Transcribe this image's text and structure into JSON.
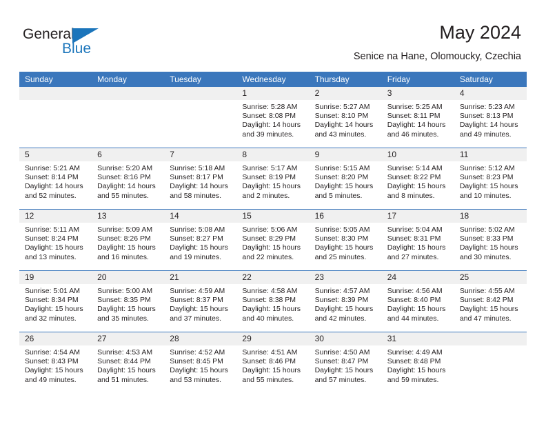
{
  "brand": {
    "name_part1": "General",
    "name_part2": "Blue",
    "accent_color": "#1b75bb"
  },
  "header": {
    "title": "May 2024",
    "subtitle": "Senice na Hane, Olomoucky, Czechia"
  },
  "theme": {
    "header_row_bg": "#3b77bc",
    "date_band_bg": "#f0f0f0",
    "separator_color": "#3b77bc",
    "text_color": "#231f20"
  },
  "weekdays": [
    "Sunday",
    "Monday",
    "Tuesday",
    "Wednesday",
    "Thursday",
    "Friday",
    "Saturday"
  ],
  "weeks": [
    {
      "days": [
        {
          "date": "",
          "empty": true,
          "sunrise": "",
          "sunset": "",
          "daylight_1": "",
          "daylight_2": ""
        },
        {
          "date": "",
          "empty": true,
          "sunrise": "",
          "sunset": "",
          "daylight_1": "",
          "daylight_2": ""
        },
        {
          "date": "",
          "empty": true,
          "sunrise": "",
          "sunset": "",
          "daylight_1": "",
          "daylight_2": ""
        },
        {
          "date": "1",
          "empty": false,
          "sunrise": "Sunrise: 5:28 AM",
          "sunset": "Sunset: 8:08 PM",
          "daylight_1": "Daylight: 14 hours",
          "daylight_2": "and 39 minutes."
        },
        {
          "date": "2",
          "empty": false,
          "sunrise": "Sunrise: 5:27 AM",
          "sunset": "Sunset: 8:10 PM",
          "daylight_1": "Daylight: 14 hours",
          "daylight_2": "and 43 minutes."
        },
        {
          "date": "3",
          "empty": false,
          "sunrise": "Sunrise: 5:25 AM",
          "sunset": "Sunset: 8:11 PM",
          "daylight_1": "Daylight: 14 hours",
          "daylight_2": "and 46 minutes."
        },
        {
          "date": "4",
          "empty": false,
          "sunrise": "Sunrise: 5:23 AM",
          "sunset": "Sunset: 8:13 PM",
          "daylight_1": "Daylight: 14 hours",
          "daylight_2": "and 49 minutes."
        }
      ]
    },
    {
      "days": [
        {
          "date": "5",
          "empty": false,
          "sunrise": "Sunrise: 5:21 AM",
          "sunset": "Sunset: 8:14 PM",
          "daylight_1": "Daylight: 14 hours",
          "daylight_2": "and 52 minutes."
        },
        {
          "date": "6",
          "empty": false,
          "sunrise": "Sunrise: 5:20 AM",
          "sunset": "Sunset: 8:16 PM",
          "daylight_1": "Daylight: 14 hours",
          "daylight_2": "and 55 minutes."
        },
        {
          "date": "7",
          "empty": false,
          "sunrise": "Sunrise: 5:18 AM",
          "sunset": "Sunset: 8:17 PM",
          "daylight_1": "Daylight: 14 hours",
          "daylight_2": "and 58 minutes."
        },
        {
          "date": "8",
          "empty": false,
          "sunrise": "Sunrise: 5:17 AM",
          "sunset": "Sunset: 8:19 PM",
          "daylight_1": "Daylight: 15 hours",
          "daylight_2": "and 2 minutes."
        },
        {
          "date": "9",
          "empty": false,
          "sunrise": "Sunrise: 5:15 AM",
          "sunset": "Sunset: 8:20 PM",
          "daylight_1": "Daylight: 15 hours",
          "daylight_2": "and 5 minutes."
        },
        {
          "date": "10",
          "empty": false,
          "sunrise": "Sunrise: 5:14 AM",
          "sunset": "Sunset: 8:22 PM",
          "daylight_1": "Daylight: 15 hours",
          "daylight_2": "and 8 minutes."
        },
        {
          "date": "11",
          "empty": false,
          "sunrise": "Sunrise: 5:12 AM",
          "sunset": "Sunset: 8:23 PM",
          "daylight_1": "Daylight: 15 hours",
          "daylight_2": "and 10 minutes."
        }
      ]
    },
    {
      "days": [
        {
          "date": "12",
          "empty": false,
          "sunrise": "Sunrise: 5:11 AM",
          "sunset": "Sunset: 8:24 PM",
          "daylight_1": "Daylight: 15 hours",
          "daylight_2": "and 13 minutes."
        },
        {
          "date": "13",
          "empty": false,
          "sunrise": "Sunrise: 5:09 AM",
          "sunset": "Sunset: 8:26 PM",
          "daylight_1": "Daylight: 15 hours",
          "daylight_2": "and 16 minutes."
        },
        {
          "date": "14",
          "empty": false,
          "sunrise": "Sunrise: 5:08 AM",
          "sunset": "Sunset: 8:27 PM",
          "daylight_1": "Daylight: 15 hours",
          "daylight_2": "and 19 minutes."
        },
        {
          "date": "15",
          "empty": false,
          "sunrise": "Sunrise: 5:06 AM",
          "sunset": "Sunset: 8:29 PM",
          "daylight_1": "Daylight: 15 hours",
          "daylight_2": "and 22 minutes."
        },
        {
          "date": "16",
          "empty": false,
          "sunrise": "Sunrise: 5:05 AM",
          "sunset": "Sunset: 8:30 PM",
          "daylight_1": "Daylight: 15 hours",
          "daylight_2": "and 25 minutes."
        },
        {
          "date": "17",
          "empty": false,
          "sunrise": "Sunrise: 5:04 AM",
          "sunset": "Sunset: 8:31 PM",
          "daylight_1": "Daylight: 15 hours",
          "daylight_2": "and 27 minutes."
        },
        {
          "date": "18",
          "empty": false,
          "sunrise": "Sunrise: 5:02 AM",
          "sunset": "Sunset: 8:33 PM",
          "daylight_1": "Daylight: 15 hours",
          "daylight_2": "and 30 minutes."
        }
      ]
    },
    {
      "days": [
        {
          "date": "19",
          "empty": false,
          "sunrise": "Sunrise: 5:01 AM",
          "sunset": "Sunset: 8:34 PM",
          "daylight_1": "Daylight: 15 hours",
          "daylight_2": "and 32 minutes."
        },
        {
          "date": "20",
          "empty": false,
          "sunrise": "Sunrise: 5:00 AM",
          "sunset": "Sunset: 8:35 PM",
          "daylight_1": "Daylight: 15 hours",
          "daylight_2": "and 35 minutes."
        },
        {
          "date": "21",
          "empty": false,
          "sunrise": "Sunrise: 4:59 AM",
          "sunset": "Sunset: 8:37 PM",
          "daylight_1": "Daylight: 15 hours",
          "daylight_2": "and 37 minutes."
        },
        {
          "date": "22",
          "empty": false,
          "sunrise": "Sunrise: 4:58 AM",
          "sunset": "Sunset: 8:38 PM",
          "daylight_1": "Daylight: 15 hours",
          "daylight_2": "and 40 minutes."
        },
        {
          "date": "23",
          "empty": false,
          "sunrise": "Sunrise: 4:57 AM",
          "sunset": "Sunset: 8:39 PM",
          "daylight_1": "Daylight: 15 hours",
          "daylight_2": "and 42 minutes."
        },
        {
          "date": "24",
          "empty": false,
          "sunrise": "Sunrise: 4:56 AM",
          "sunset": "Sunset: 8:40 PM",
          "daylight_1": "Daylight: 15 hours",
          "daylight_2": "and 44 minutes."
        },
        {
          "date": "25",
          "empty": false,
          "sunrise": "Sunrise: 4:55 AM",
          "sunset": "Sunset: 8:42 PM",
          "daylight_1": "Daylight: 15 hours",
          "daylight_2": "and 47 minutes."
        }
      ]
    },
    {
      "days": [
        {
          "date": "26",
          "empty": false,
          "sunrise": "Sunrise: 4:54 AM",
          "sunset": "Sunset: 8:43 PM",
          "daylight_1": "Daylight: 15 hours",
          "daylight_2": "and 49 minutes."
        },
        {
          "date": "27",
          "empty": false,
          "sunrise": "Sunrise: 4:53 AM",
          "sunset": "Sunset: 8:44 PM",
          "daylight_1": "Daylight: 15 hours",
          "daylight_2": "and 51 minutes."
        },
        {
          "date": "28",
          "empty": false,
          "sunrise": "Sunrise: 4:52 AM",
          "sunset": "Sunset: 8:45 PM",
          "daylight_1": "Daylight: 15 hours",
          "daylight_2": "and 53 minutes."
        },
        {
          "date": "29",
          "empty": false,
          "sunrise": "Sunrise: 4:51 AM",
          "sunset": "Sunset: 8:46 PM",
          "daylight_1": "Daylight: 15 hours",
          "daylight_2": "and 55 minutes."
        },
        {
          "date": "30",
          "empty": false,
          "sunrise": "Sunrise: 4:50 AM",
          "sunset": "Sunset: 8:47 PM",
          "daylight_1": "Daylight: 15 hours",
          "daylight_2": "and 57 minutes."
        },
        {
          "date": "31",
          "empty": false,
          "sunrise": "Sunrise: 4:49 AM",
          "sunset": "Sunset: 8:48 PM",
          "daylight_1": "Daylight: 15 hours",
          "daylight_2": "and 59 minutes."
        },
        {
          "date": "",
          "empty": true,
          "sunrise": "",
          "sunset": "",
          "daylight_1": "",
          "daylight_2": ""
        }
      ]
    }
  ]
}
